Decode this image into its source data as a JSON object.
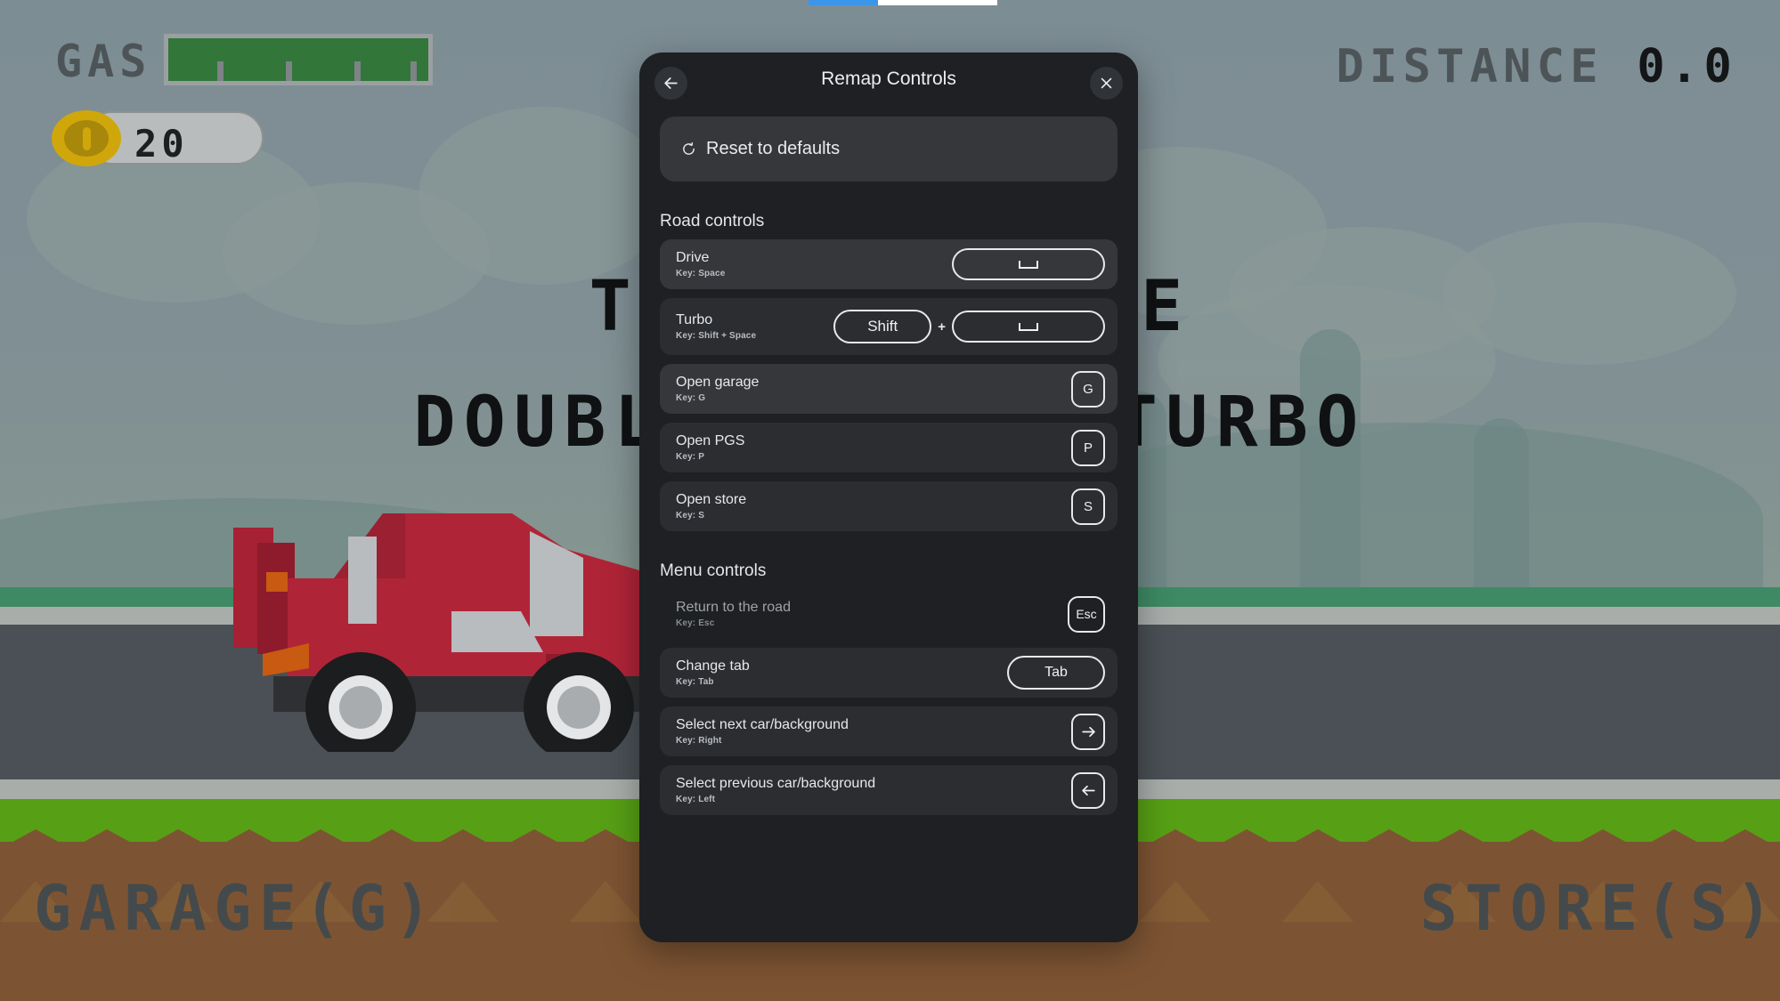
{
  "game": {
    "gas_label": "GAS",
    "gas_percent": 100,
    "gas_ticks": 4,
    "coin_count": "20",
    "distance_label": "DISTANCE",
    "distance_value": "0.0",
    "hint_line_1": "TAP TO DRIVE",
    "hint_line_2": "DOUBLE TAP TO TURBO",
    "corner_left": "GARAGE(G)",
    "corner_right": "STORE(S)",
    "colors": {
      "sky": "#7d8d94",
      "grass_far": "#3e8a64",
      "shoulder": "#a9adaa",
      "road": "#4a5055",
      "grass_near": "#57a015",
      "dirt": "#7d5433",
      "car_body": "#b02437",
      "coin": "#cfa70b",
      "gas_fill": "#32763a"
    }
  },
  "browser": {
    "progress_accent": "#3b96ea"
  },
  "dialog": {
    "title": "Remap Controls",
    "back_icon": "arrow-left-icon",
    "close_icon": "close-icon",
    "reset": {
      "icon": "reset-icon",
      "label": "Reset to defaults"
    },
    "sections": [
      {
        "title": "Road controls",
        "rows": [
          {
            "label": "Drive",
            "key_text": "Key: Space",
            "state": "hovered",
            "keys": [
              {
                "type": "spacebar",
                "label": ""
              }
            ]
          },
          {
            "label": "Turbo",
            "key_text": "Key: Shift + Space",
            "state": "normal",
            "keys": [
              {
                "type": "shift",
                "label": "Shift"
              },
              {
                "type": "plus",
                "label": "+"
              },
              {
                "type": "spacebar",
                "label": ""
              }
            ]
          },
          {
            "label": "Open garage",
            "key_text": "Key: G",
            "state": "hovered",
            "keys": [
              {
                "type": "square",
                "label": "G"
              }
            ]
          },
          {
            "label": "Open PGS",
            "key_text": "Key: P",
            "state": "normal",
            "keys": [
              {
                "type": "square",
                "label": "P"
              }
            ]
          },
          {
            "label": "Open store",
            "key_text": "Key: S",
            "state": "normal",
            "keys": [
              {
                "type": "square",
                "label": "S"
              }
            ]
          }
        ]
      },
      {
        "title": "Menu controls",
        "rows": [
          {
            "label": "Return to the road",
            "key_text": "Key: Esc",
            "state": "plain",
            "keys": [
              {
                "type": "esc",
                "label": "Esc"
              }
            ]
          },
          {
            "label": "Change tab",
            "key_text": "Key: Tab",
            "state": "normal",
            "keys": [
              {
                "type": "tab",
                "label": "Tab"
              }
            ]
          },
          {
            "label": "Select next car/background",
            "key_text": "Key: Right",
            "state": "normal",
            "keys": [
              {
                "type": "arrow-right",
                "label": ""
              }
            ]
          },
          {
            "label": "Select previous car/background",
            "key_text": "Key: Left",
            "state": "normal",
            "keys": [
              {
                "type": "arrow-left",
                "label": ""
              }
            ]
          }
        ]
      }
    ]
  }
}
